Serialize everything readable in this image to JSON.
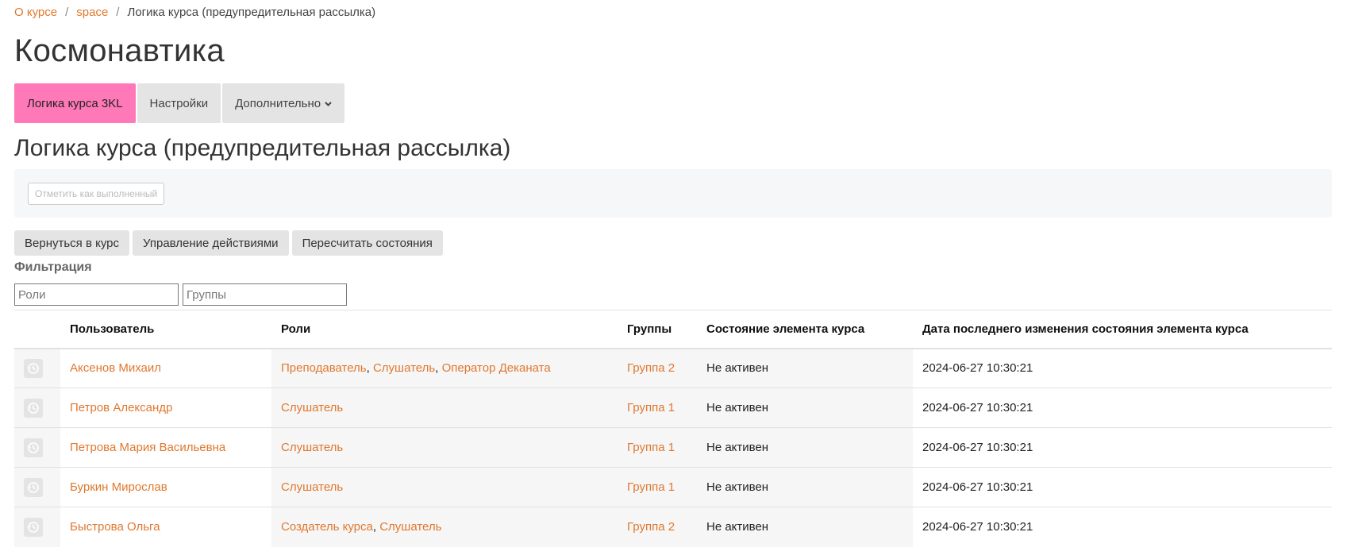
{
  "breadcrumb": {
    "items": [
      "О курсе",
      "space"
    ],
    "separator": "/",
    "current": "Логика курса (предупредительная рассылка)"
  },
  "page_title": "Космонавтика",
  "tabs": [
    {
      "label": "Логика курса 3KL",
      "active": true
    },
    {
      "label": "Настройки",
      "active": false
    },
    {
      "label": "Дополнительно",
      "active": false,
      "icon": "chevron-down-icon"
    }
  ],
  "section_title": "Логика курса (предупредительная рассылка)",
  "mark_complete_label": "Отметить как выполненный",
  "actions": {
    "back": "Вернуться в курс",
    "manage": "Управление действиями",
    "recalc": "Пересчитать состояния"
  },
  "filter": {
    "label": "Фильтрация",
    "roles_placeholder": "Роли",
    "groups_placeholder": "Группы"
  },
  "table": {
    "headers": {
      "user": "Пользователь",
      "roles": "Роли",
      "groups": "Группы",
      "state": "Состояние элемента курса",
      "date": "Дата последнего изменения состояния элемента курса"
    },
    "rows": [
      {
        "user": "Аксенов Михаил",
        "roles": [
          "Преподаватель",
          "Слушатель",
          "Оператор Деканата"
        ],
        "group": "Группа 2",
        "state": "Не активен",
        "date": "2024-06-27 10:30:21"
      },
      {
        "user": "Петров Александр",
        "roles": [
          "Слушатель"
        ],
        "group": "Группа 1",
        "state": "Не активен",
        "date": "2024-06-27 10:30:21"
      },
      {
        "user": "Петрова Мария Васильевна",
        "roles": [
          "Слушатель"
        ],
        "group": "Группа 1",
        "state": "Не активен",
        "date": "2024-06-27 10:30:21"
      },
      {
        "user": "Буркин Мирослав",
        "roles": [
          "Слушатель"
        ],
        "group": "Группа 1",
        "state": "Не активен",
        "date": "2024-06-27 10:30:21"
      },
      {
        "user": "Быстрова Ольга",
        "roles": [
          "Создатель курса",
          "Слушатель"
        ],
        "group": "Группа 2",
        "state": "Не активен",
        "date": "2024-06-27 10:30:21"
      }
    ]
  },
  "colors": {
    "link": "#e0782f",
    "active_tab": "#ff79b8",
    "button_bg": "#e4e4e4"
  }
}
